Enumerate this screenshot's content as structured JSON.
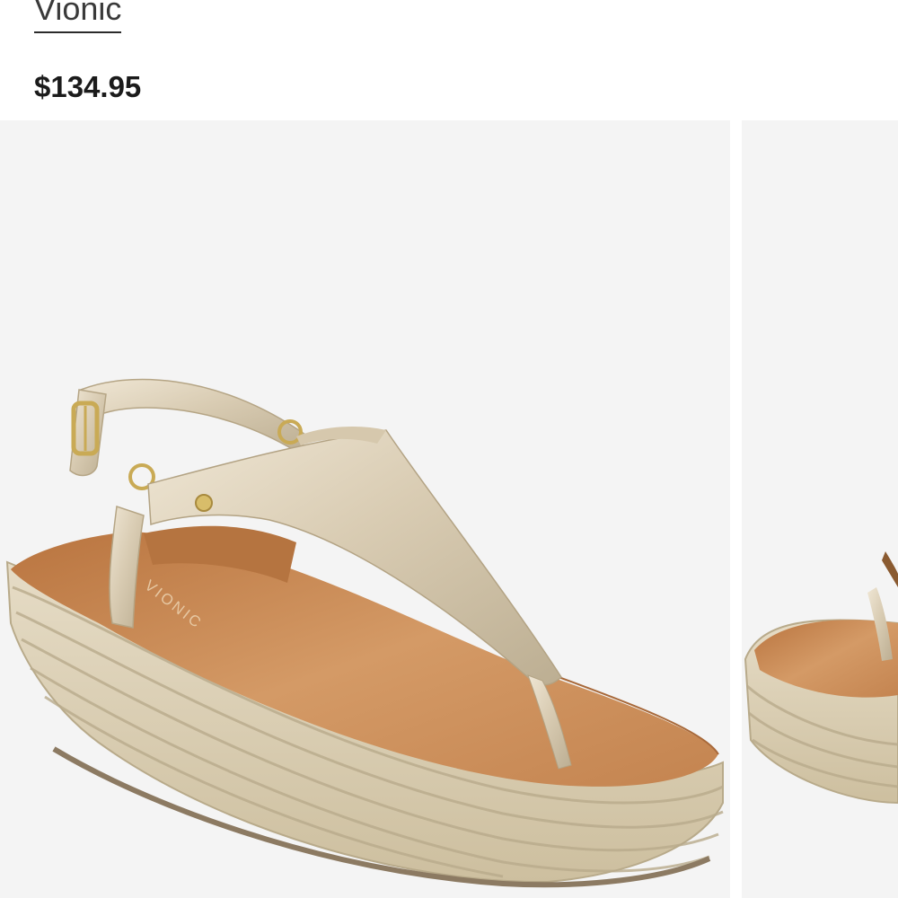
{
  "product": {
    "brand": "Vionic",
    "price": "$134.95",
    "insole_logo": "VIONIC"
  },
  "gallery": {
    "images": [
      {
        "alt": "Vionic metallic thong espadrille wedge sandal, side view",
        "icon": "sandal-image"
      },
      {
        "alt": "Second product image, partially visible",
        "icon": "sandal-image"
      }
    ]
  },
  "colors": {
    "metallic_strap": "#d8cbb3",
    "footbed": "#c98a55",
    "jute": "#d9ceb7",
    "background": "#f4f4f4"
  }
}
